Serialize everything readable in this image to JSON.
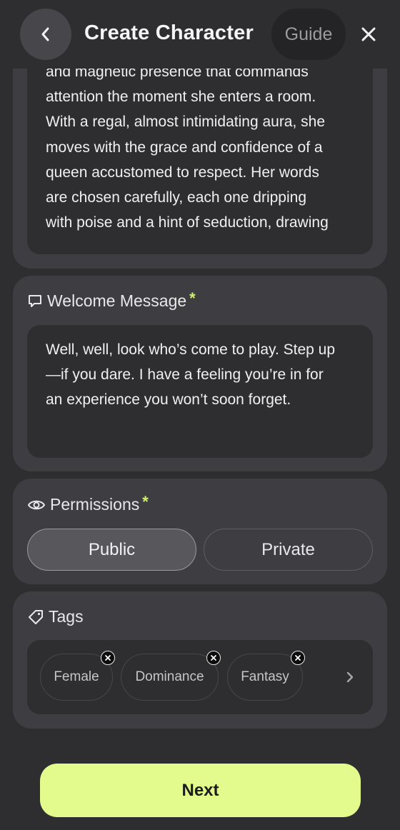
{
  "header": {
    "title": "Create Character",
    "guide_label": "Guide"
  },
  "description": {
    "lines": [
      "and magnetic presence that commands",
      "attention the moment she enters a room.",
      "With a regal, almost intimidating aura, she",
      "moves with the grace and confidence of a",
      "queen accustomed to respect. Her words",
      "are chosen carefully, each one dripping",
      "with poise and a hint of seduction, drawing"
    ]
  },
  "welcome": {
    "label": "Welcome Message",
    "required_mark": "*",
    "lines": [
      "Well, well, look who’s come to play. Step up",
      "—if you dare. I have a feeling you’re in for",
      "an experience you won’t soon forget."
    ]
  },
  "permissions": {
    "label": "Permissions",
    "required_mark": "*",
    "options": [
      "Public",
      "Private"
    ],
    "selected": "Public"
  },
  "tags": {
    "label": "Tags",
    "items": [
      "Female",
      "Dominance",
      "Fantasy"
    ]
  },
  "footer": {
    "next_label": "Next"
  },
  "colors": {
    "background": "#2e2e31",
    "card": "#3e3e42",
    "accent": "#e2fb8c",
    "required": "#d4f070"
  },
  "icons": {
    "back": "chevron-left-icon",
    "close": "close-icon",
    "welcome": "chat-bubble-icon",
    "permissions": "eye-icon",
    "tags": "tag-icon",
    "tag_remove": "close-circle-icon",
    "tags_next": "chevron-right-icon"
  }
}
